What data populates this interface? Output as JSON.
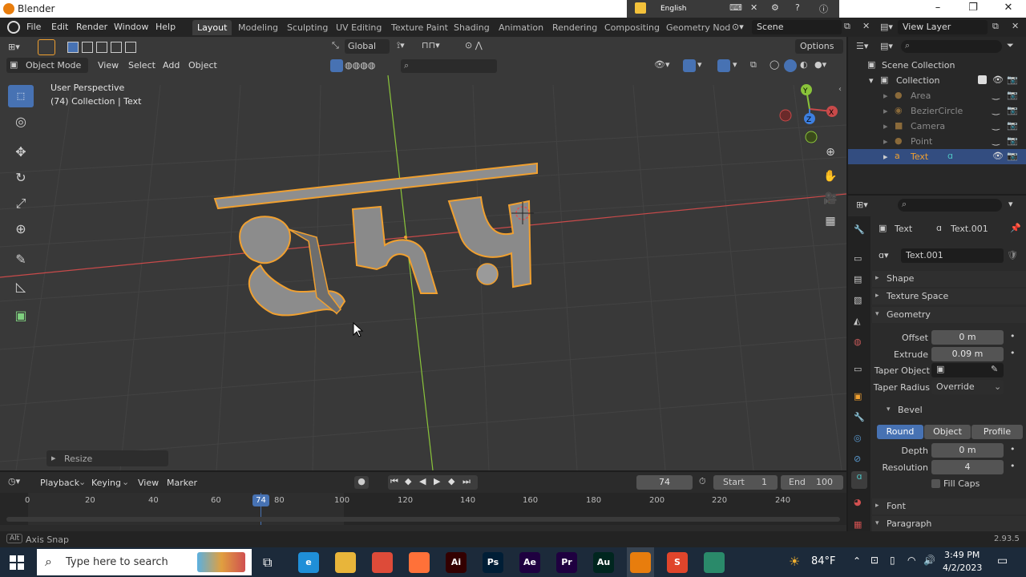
{
  "app": {
    "title": "Blender",
    "version": "2.93.5"
  },
  "langbar": {
    "language": "English"
  },
  "menu": {
    "items": [
      "File",
      "Edit",
      "Render",
      "Window",
      "Help"
    ]
  },
  "workspaces": {
    "tabs": [
      "Layout",
      "Modeling",
      "Sculpting",
      "UV Editing",
      "Texture Paint",
      "Shading",
      "Animation",
      "Rendering",
      "Compositing",
      "Geometry Nod"
    ],
    "active": "Layout"
  },
  "scene": {
    "name": "Scene",
    "view_layer": "View Layer"
  },
  "viewport": {
    "mode": "Object Mode",
    "menus": [
      "View",
      "Select",
      "Add",
      "Object"
    ],
    "orientation": "Global",
    "options_label": "Options",
    "perspective": "User Perspective",
    "collection_info": "(74) Collection | Text",
    "resize_panel": "Resize",
    "gizmo": {
      "x": "X",
      "y": "Y",
      "z": "Z"
    }
  },
  "outliner": {
    "root": "Scene Collection",
    "collection": "Collection",
    "objects": [
      {
        "name": "Area",
        "selected": false
      },
      {
        "name": "BezierCircle",
        "selected": false
      },
      {
        "name": "Camera",
        "selected": false
      },
      {
        "name": "Point",
        "selected": false
      },
      {
        "name": "Text",
        "selected": true
      }
    ]
  },
  "properties": {
    "object_name": "Text",
    "data_name": "Text.001",
    "data_field": "Text.001",
    "panels": {
      "shape": "Shape",
      "texture_space": "Texture Space",
      "geometry": "Geometry",
      "bevel": "Bevel",
      "font": "Font",
      "paragraph": "Paragraph"
    },
    "geometry": {
      "offset_label": "Offset",
      "offset": "0 m",
      "extrude_label": "Extrude",
      "extrude": "0.09 m",
      "taper_object_label": "Taper Object",
      "taper_radius_label": "Taper Radius",
      "taper_radius": "Override"
    },
    "bevel": {
      "modes": [
        "Round",
        "Object",
        "Profile"
      ],
      "active_mode": "Round",
      "depth_label": "Depth",
      "depth": "0 m",
      "resolution_label": "Resolution",
      "resolution": "4",
      "fill_caps_label": "Fill Caps"
    }
  },
  "timeline": {
    "menus": [
      "Playback",
      "Keying",
      "View",
      "Marker"
    ],
    "current_frame": "74",
    "start_label": "Start",
    "start": "1",
    "end_label": "End",
    "end": "100",
    "ticks": [
      "0",
      "20",
      "40",
      "60",
      "80",
      "100",
      "120",
      "140",
      "160",
      "180",
      "200",
      "220",
      "240"
    ],
    "playhead": "74"
  },
  "status": {
    "key": "Alt",
    "hint": "Axis Snap",
    "version": "2.93.5"
  },
  "taskbar": {
    "search_placeholder": "Type here to search",
    "apps": [
      {
        "name": "Edge",
        "color": "#1f8fd8",
        "glyph": "e"
      },
      {
        "name": "File Explorer",
        "color": "#e8b53a",
        "glyph": ""
      },
      {
        "name": "Chrome",
        "color": "#dd4b39",
        "glyph": ""
      },
      {
        "name": "Firefox",
        "color": "#ff7139",
        "glyph": ""
      },
      {
        "name": "Illustrator",
        "color": "#330000",
        "glyph": "Ai"
      },
      {
        "name": "Photoshop",
        "color": "#001e36",
        "glyph": "Ps"
      },
      {
        "name": "After Effects",
        "color": "#1f0040",
        "glyph": "Ae"
      },
      {
        "name": "Premiere",
        "color": "#1f0040",
        "glyph": "Pr"
      },
      {
        "name": "Audition",
        "color": "#00261f",
        "glyph": "Au"
      },
      {
        "name": "Blender",
        "color": "#e87d0d",
        "glyph": ""
      },
      {
        "name": "Sublime",
        "color": "#e0452b",
        "glyph": "S"
      },
      {
        "name": "Back",
        "color": "#2a8a6a",
        "glyph": ""
      }
    ],
    "weather": "84°F",
    "time": "3:49 PM",
    "date": "4/2/2023"
  },
  "colors": {
    "accent": "#4772b3",
    "selection_orange": "#f0a030",
    "x_axis": "#c84a4a",
    "y_axis": "#8ac43a",
    "z_axis": "#3d7fe0"
  }
}
